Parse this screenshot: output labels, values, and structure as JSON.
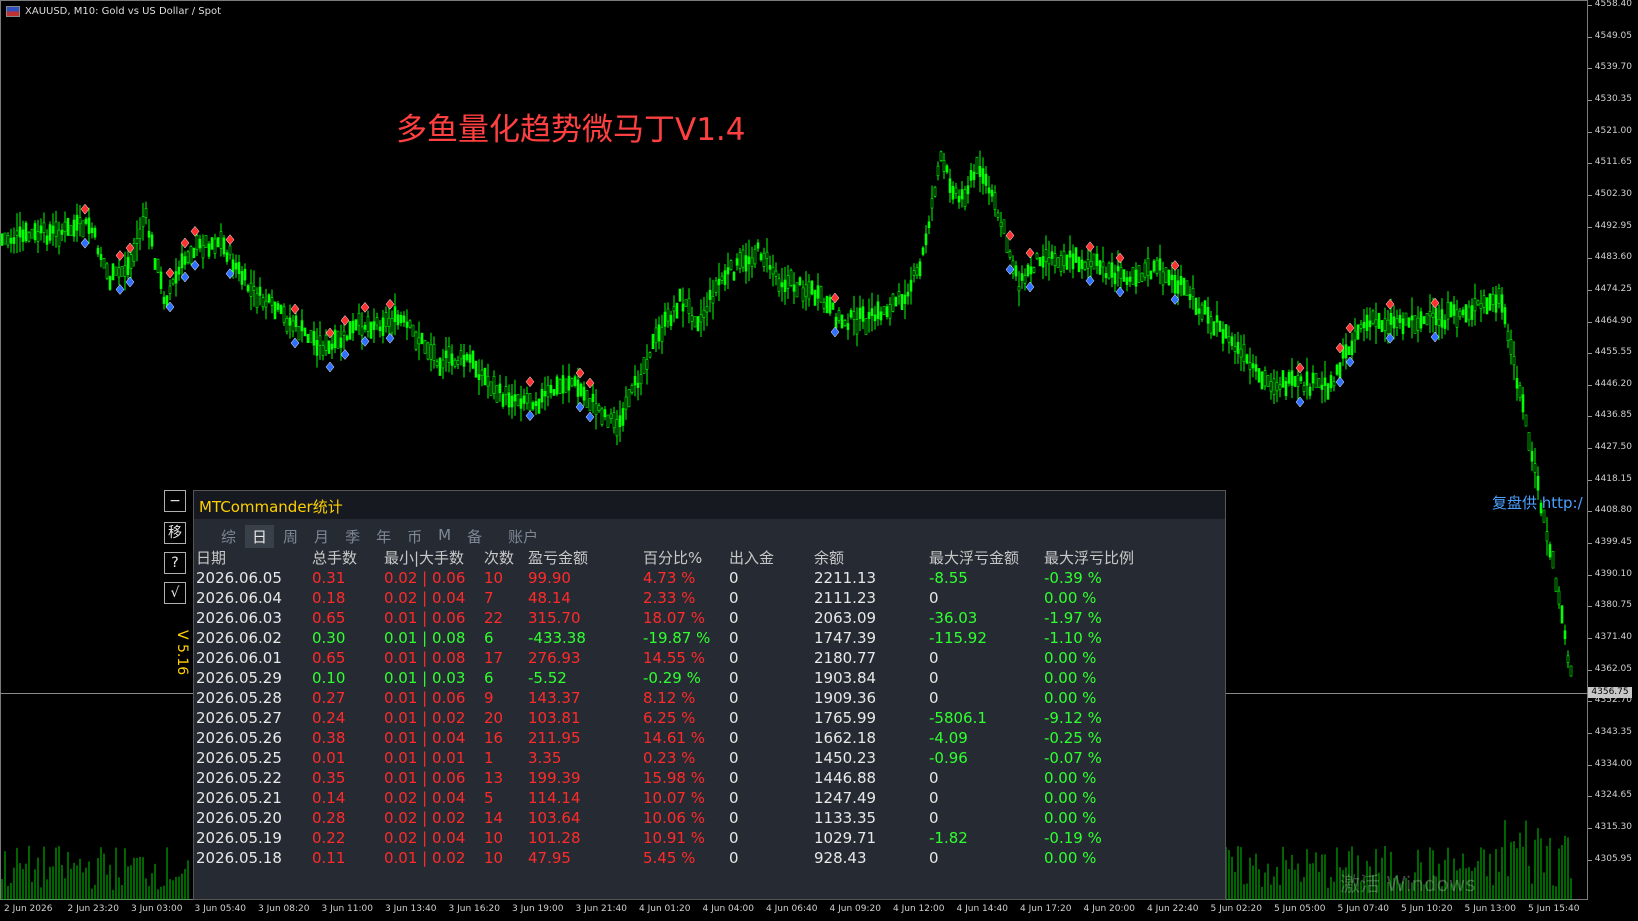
{
  "symbol_bar": {
    "text": "XAUUSD, M10:  Gold vs US Dollar / Spot"
  },
  "strategy_title": "多鱼量化趋势微马丁V1.4",
  "price_scale": {
    "labels": [
      "4558.40",
      "4549.05",
      "4539.70",
      "4530.35",
      "4521.00",
      "4511.65",
      "4502.30",
      "4492.95",
      "4483.60",
      "4474.25",
      "4464.90",
      "4455.55",
      "4446.20",
      "4436.85",
      "4427.50",
      "4418.15",
      "4408.80",
      "4399.45",
      "4390.10",
      "4380.75",
      "4371.40",
      "4362.05",
      "4352.70",
      "4343.35",
      "4334.00",
      "4324.65",
      "4315.30",
      "4305.95"
    ],
    "current": "4356.75"
  },
  "time_scale": {
    "labels": [
      "2 Jun 2026",
      "2 Jun 23:20",
      "3 Jun 03:00",
      "3 Jun 05:40",
      "3 Jun 08:20",
      "3 Jun 11:00",
      "3 Jun 13:40",
      "3 Jun 16:20",
      "3 Jun 19:00",
      "3 Jun 21:40",
      "4 Jun 01:20",
      "4 Jun 04:00",
      "4 Jun 06:40",
      "4 Jun 09:20",
      "4 Jun 12:00",
      "4 Jun 14:40",
      "4 Jun 17:20",
      "4 Jun 20:00",
      "4 Jun 22:40",
      "5 Jun 02:20",
      "5 Jun 05:00",
      "5 Jun 07:40",
      "5 Jun 10:20",
      "5 Jun 13:00",
      "5 Jun 15:40"
    ]
  },
  "panel": {
    "title": "MTCommander统计",
    "tabs": [
      "综",
      "日",
      "周",
      "月",
      "季",
      "年",
      "币",
      "M",
      "备",
      "账户"
    ],
    "active_tab": "日",
    "side_buttons": [
      "−",
      "移",
      "?",
      "√"
    ],
    "version": "V 5.16",
    "headers": [
      "日期",
      "总手数",
      "最小|大手数",
      "次数",
      "盈亏金额",
      "百分比%",
      "出入金",
      "余额",
      "最大浮亏金额",
      "最大浮亏比例"
    ],
    "rows": [
      {
        "date": "2026.06.05",
        "lots": "0.31",
        "minmax": "0.02 | 0.06",
        "count": "10",
        "pnl": "99.90",
        "pct": "4.73 %",
        "io": "0",
        "bal": "2211.13",
        "mdd": "-8.55",
        "mddp": "-0.39 %",
        "color": "red"
      },
      {
        "date": "2026.06.04",
        "lots": "0.18",
        "minmax": "0.02 | 0.04",
        "count": "7",
        "pnl": "48.14",
        "pct": "2.33 %",
        "io": "0",
        "bal": "2111.23",
        "mdd": "0",
        "mddp": "0.00 %",
        "color": "red"
      },
      {
        "date": "2026.06.03",
        "lots": "0.65",
        "minmax": "0.01 | 0.06",
        "count": "22",
        "pnl": "315.70",
        "pct": "18.07 %",
        "io": "0",
        "bal": "2063.09",
        "mdd": "-36.03",
        "mddp": "-1.97 %",
        "color": "red"
      },
      {
        "date": "2026.06.02",
        "lots": "0.30",
        "minmax": "0.01 | 0.08",
        "count": "6",
        "pnl": "-433.38",
        "pct": "-19.87 %",
        "io": "0",
        "bal": "1747.39",
        "mdd": "-115.92",
        "mddp": "-1.10 %",
        "color": "green"
      },
      {
        "date": "2026.06.01",
        "lots": "0.65",
        "minmax": "0.01 | 0.08",
        "count": "17",
        "pnl": "276.93",
        "pct": "14.55 %",
        "io": "0",
        "bal": "2180.77",
        "mdd": "0",
        "mddp": "0.00 %",
        "color": "red"
      },
      {
        "date": "2026.05.29",
        "lots": "0.10",
        "minmax": "0.01 | 0.03",
        "count": "6",
        "pnl": "-5.52",
        "pct": "-0.29 %",
        "io": "0",
        "bal": "1903.84",
        "mdd": "0",
        "mddp": "0.00 %",
        "color": "green"
      },
      {
        "date": "2026.05.28",
        "lots": "0.27",
        "minmax": "0.01 | 0.06",
        "count": "9",
        "pnl": "143.37",
        "pct": "8.12 %",
        "io": "0",
        "bal": "1909.36",
        "mdd": "0",
        "mddp": "0.00 %",
        "color": "red"
      },
      {
        "date": "2026.05.27",
        "lots": "0.24",
        "minmax": "0.01 | 0.02",
        "count": "20",
        "pnl": "103.81",
        "pct": "6.25 %",
        "io": "0",
        "bal": "1765.99",
        "mdd": "-5806.1",
        "mddp": "-9.12 %",
        "color": "red"
      },
      {
        "date": "2026.05.26",
        "lots": "0.38",
        "minmax": "0.01 | 0.04",
        "count": "16",
        "pnl": "211.95",
        "pct": "14.61 %",
        "io": "0",
        "bal": "1662.18",
        "mdd": "-4.09",
        "mddp": "-0.25 %",
        "color": "red"
      },
      {
        "date": "2026.05.25",
        "lots": "0.01",
        "minmax": "0.01 | 0.01",
        "count": "1",
        "pnl": "3.35",
        "pct": "0.23 %",
        "io": "0",
        "bal": "1450.23",
        "mdd": "-0.96",
        "mddp": "-0.07 %",
        "color": "red"
      },
      {
        "date": "2026.05.22",
        "lots": "0.35",
        "minmax": "0.01 | 0.06",
        "count": "13",
        "pnl": "199.39",
        "pct": "15.98 %",
        "io": "0",
        "bal": "1446.88",
        "mdd": "0",
        "mddp": "0.00 %",
        "color": "red"
      },
      {
        "date": "2026.05.21",
        "lots": "0.14",
        "minmax": "0.02 | 0.04",
        "count": "5",
        "pnl": "114.14",
        "pct": "10.07 %",
        "io": "0",
        "bal": "1247.49",
        "mdd": "0",
        "mddp": "0.00 %",
        "color": "red"
      },
      {
        "date": "2026.05.20",
        "lots": "0.28",
        "minmax": "0.02 | 0.02",
        "count": "14",
        "pnl": "103.64",
        "pct": "10.06 %",
        "io": "0",
        "bal": "1133.35",
        "mdd": "0",
        "mddp": "0.00 %",
        "color": "red"
      },
      {
        "date": "2026.05.19",
        "lots": "0.22",
        "minmax": "0.02 | 0.04",
        "count": "10",
        "pnl": "101.28",
        "pct": "10.91 %",
        "io": "0",
        "bal": "1029.71",
        "mdd": "-1.82",
        "mddp": "-0.19 %",
        "color": "red"
      },
      {
        "date": "2026.05.18",
        "lots": "0.11",
        "minmax": "0.01 | 0.02",
        "count": "10",
        "pnl": "47.95",
        "pct": "5.45 %",
        "io": "0",
        "bal": "928.43",
        "mdd": "0",
        "mddp": "0.00 %",
        "color": "red"
      }
    ]
  },
  "replay_text": "复盘供 http:/",
  "watermark": "激活 Windows",
  "colors": {
    "bull": "#00ff00",
    "bear": "#00ff00",
    "title": "#ff4040",
    "panel_title": "#ffd000",
    "profit": "#ff2a2a",
    "loss": "#30ff30"
  }
}
